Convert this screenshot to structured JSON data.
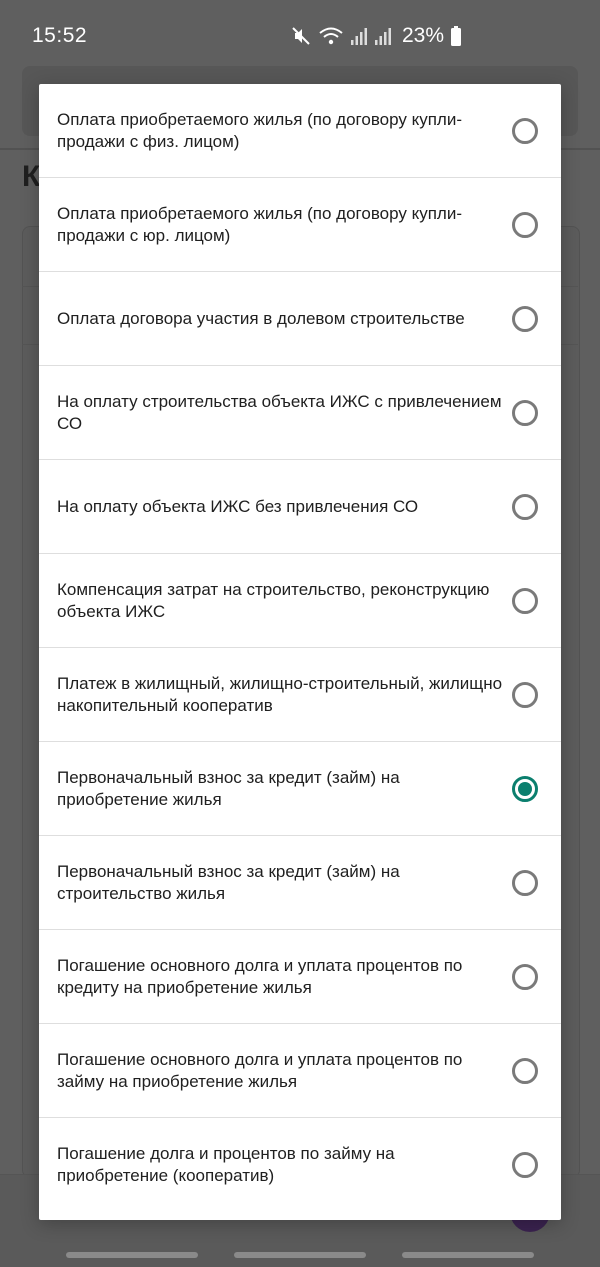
{
  "status_bar": {
    "time": "15:52",
    "battery_percent": "23%",
    "icons": [
      "mute-icon",
      "wifi-icon",
      "signal-icon",
      "signal-icon",
      "battery-icon"
    ]
  },
  "background": {
    "heading_partial": "К"
  },
  "dialog": {
    "selected_index": 7,
    "accent_color": "#0b7f6e",
    "options": [
      {
        "label": "Оплата приобретаемого жилья (по договору купли-продажи с физ. лицом)"
      },
      {
        "label": "Оплата приобретаемого жилья (по договору купли-продажи с юр. лицом)"
      },
      {
        "label": "Оплата договора участия в долевом строительстве"
      },
      {
        "label": "На оплату строительства объекта ИЖС с привлечением СО"
      },
      {
        "label": "На оплату объекта ИЖС без привлечения СО"
      },
      {
        "label": "Компенсация затрат на строительство, реконструкцию объекта ИЖС"
      },
      {
        "label": "Платеж в жилищный, жилищно-строительный, жилищно накопительный кооператив"
      },
      {
        "label": "Первоначальный взнос за кредит (займ) на приобретение жилья"
      },
      {
        "label": "Первоначальный взнос за кредит (займ) на строительство жилья"
      },
      {
        "label": "Погашение основного долга и уплата процентов по кредиту на приобретение жилья"
      },
      {
        "label": "Погашение основного долга и уплата процентов по займу на приобретение жилья"
      },
      {
        "label": "Погашение долга и процентов по займу на приобретение (кооператив)"
      }
    ]
  }
}
